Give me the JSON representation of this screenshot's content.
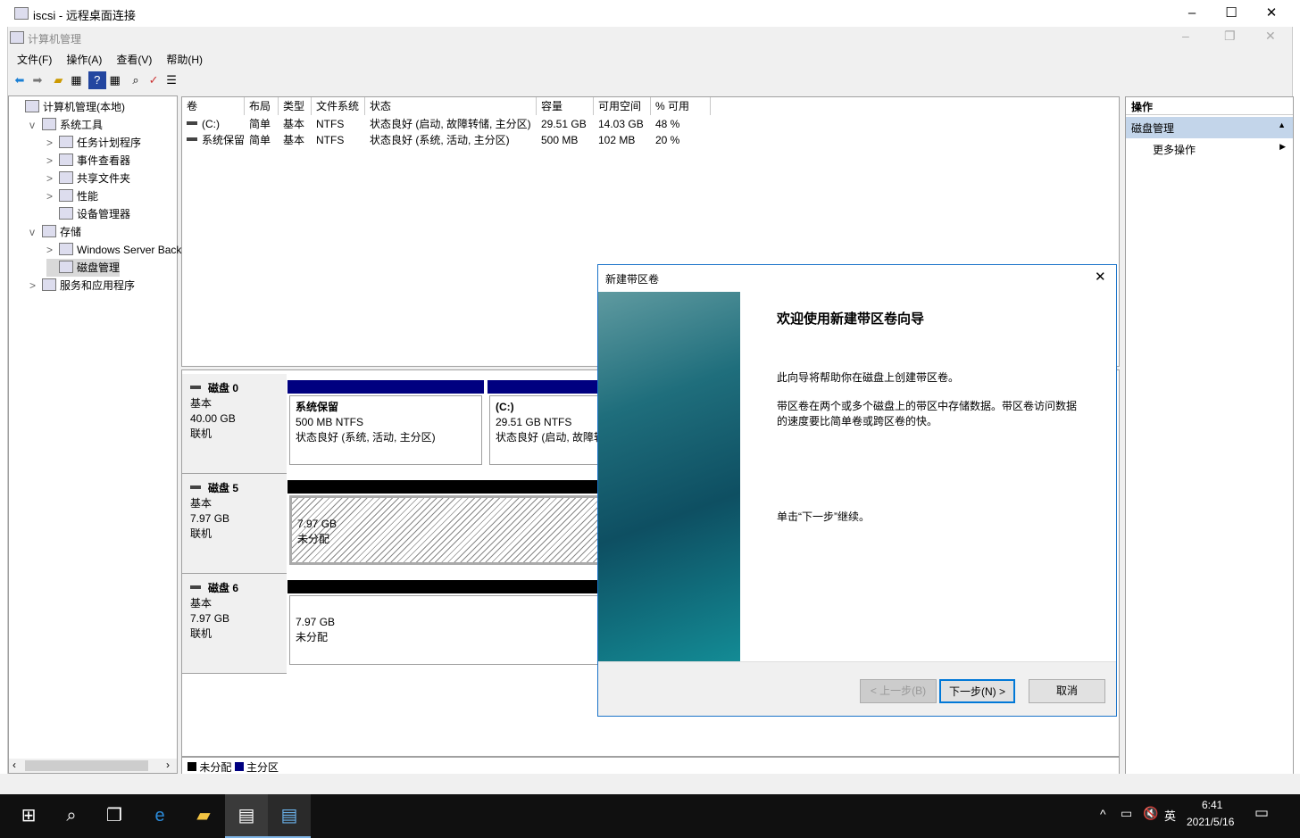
{
  "rdp": {
    "title": "iscsi - 远程桌面连接"
  },
  "app": {
    "title": "计算机管理",
    "menu": [
      "文件(F)",
      "操作(A)",
      "查看(V)",
      "帮助(H)"
    ]
  },
  "tree": [
    {
      "label": "计算机管理(本地)",
      "level": 0,
      "expander": ""
    },
    {
      "label": "系统工具",
      "level": 1,
      "expander": "v"
    },
    {
      "label": "任务计划程序",
      "level": 2,
      "expander": ">"
    },
    {
      "label": "事件查看器",
      "level": 2,
      "expander": ">"
    },
    {
      "label": "共享文件夹",
      "level": 2,
      "expander": ">"
    },
    {
      "label": "性能",
      "level": 2,
      "expander": ">"
    },
    {
      "label": "设备管理器",
      "level": 2,
      "expander": ""
    },
    {
      "label": "存储",
      "level": 1,
      "expander": "v"
    },
    {
      "label": "Windows Server Back",
      "level": 2,
      "expander": ">"
    },
    {
      "label": "磁盘管理",
      "level": 2,
      "expander": "",
      "selected": true
    },
    {
      "label": "服务和应用程序",
      "level": 1,
      "expander": ">"
    }
  ],
  "volumes": {
    "columns": [
      "卷",
      "布局",
      "类型",
      "文件系统",
      "状态",
      "容量",
      "可用空间",
      "% 可用"
    ],
    "rows": [
      [
        "(C:)",
        "简单",
        "基本",
        "NTFS",
        "状态良好 (启动, 故障转储, 主分区)",
        "29.51 GB",
        "14.03 GB",
        "48 %"
      ],
      [
        "系统保留",
        "简单",
        "基本",
        "NTFS",
        "状态良好 (系统, 活动, 主分区)",
        "500 MB",
        "102 MB",
        "20 %"
      ]
    ]
  },
  "disks": [
    {
      "name": "磁盘 0",
      "type": "基本",
      "size": "40.00 GB",
      "status": "联机",
      "partitions": [
        {
          "title": "系统保留",
          "size": "500 MB NTFS",
          "status": "状态良好 (系统, 活动, 主分区)"
        },
        {
          "title": "(C:)",
          "size": "29.51 GB NTFS",
          "status": "状态良好 (启动, 故障转储, 主分区)"
        }
      ]
    },
    {
      "name": "磁盘 5",
      "type": "基本",
      "size": "7.97 GB",
      "status": "联机",
      "partitions": [
        {
          "size": "7.97 GB",
          "status": "未分配"
        }
      ]
    },
    {
      "name": "磁盘 6",
      "type": "基本",
      "size": "7.97 GB",
      "status": "联机",
      "partitions": [
        {
          "size": "7.97 GB",
          "status": "未分配"
        }
      ]
    }
  ],
  "legend": [
    {
      "label": "未分配",
      "color": "#000000"
    },
    {
      "label": "主分区",
      "color": "#000080"
    }
  ],
  "actions": {
    "header": "操作",
    "section": "磁盘管理",
    "items": [
      "更多操作"
    ]
  },
  "dialog": {
    "title": "新建带区卷",
    "heading": "欢迎使用新建带区卷向导",
    "p1": "此向导将帮助你在磁盘上创建带区卷。",
    "p2": "带区卷在两个或多个磁盘上的带区中存储数据。带区卷访问数据的速度要比简单卷或跨区卷的快。",
    "p3": "单击“下一步”继续。",
    "back": "< 上一步(B)",
    "next": "下一步(N) >",
    "cancel": "取消"
  },
  "tray": {
    "ime": "英",
    "time": "6:41",
    "date": "2021/5/16"
  }
}
